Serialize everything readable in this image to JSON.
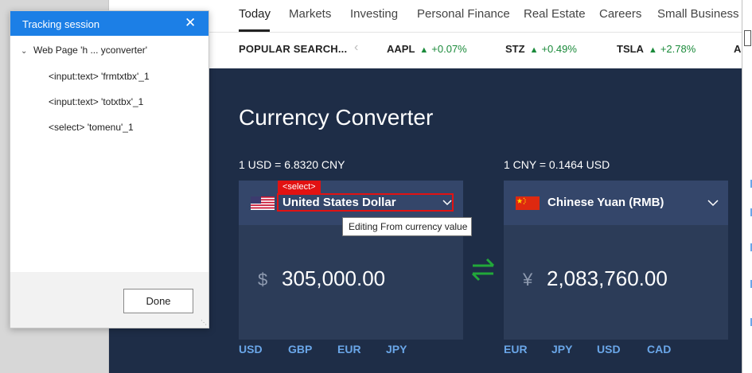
{
  "nav": {
    "items": [
      "Today",
      "Markets",
      "Investing",
      "Personal Finance",
      "Real Estate",
      "Careers",
      "Small Business"
    ],
    "active": "Today"
  },
  "ticker": {
    "label": "POPULAR SEARCH...",
    "prev_arrow": "‹",
    "items": [
      {
        "symbol": "AAPL",
        "arrow": "▲",
        "change": "+0.07%"
      },
      {
        "symbol": "STZ",
        "arrow": "▲",
        "change": "+0.49%"
      },
      {
        "symbol": "TSLA",
        "arrow": "▲",
        "change": "+2.78%"
      },
      {
        "symbol": "AM",
        "arrow": "",
        "change": ""
      }
    ]
  },
  "converter": {
    "title": "Currency Converter",
    "from": {
      "rate": "1 USD = 6.8320 CNY",
      "currency": "United States Dollar",
      "symbol": "$",
      "amount": "305,000.00",
      "quick": [
        "USD",
        "GBP",
        "EUR",
        "JPY"
      ]
    },
    "to": {
      "rate": "1 CNY = 0.1464 USD",
      "currency": "Chinese Yuan (RMB)",
      "symbol": "¥",
      "amount": "2,083,760.00",
      "quick": [
        "EUR",
        "JPY",
        "USD",
        "CAD"
      ]
    },
    "select_tag": "<select>",
    "tooltip": "Editing From currency value"
  },
  "dialog": {
    "title": "Tracking session",
    "close": "✕",
    "root": "Web Page 'h ... yconverter'",
    "children": [
      "<input:text> 'frmtxtbx'_1",
      "<input:text> 'totxtbx'_1",
      "<select> 'tomenu'_1"
    ],
    "done_label": "Done"
  },
  "colors": {
    "panel_bg": "#1e2d47",
    "accent_blue": "#1c7fe6",
    "positive": "#1a8a3a",
    "highlight_red": "#e21212",
    "currency_link": "#6aa6e8"
  }
}
